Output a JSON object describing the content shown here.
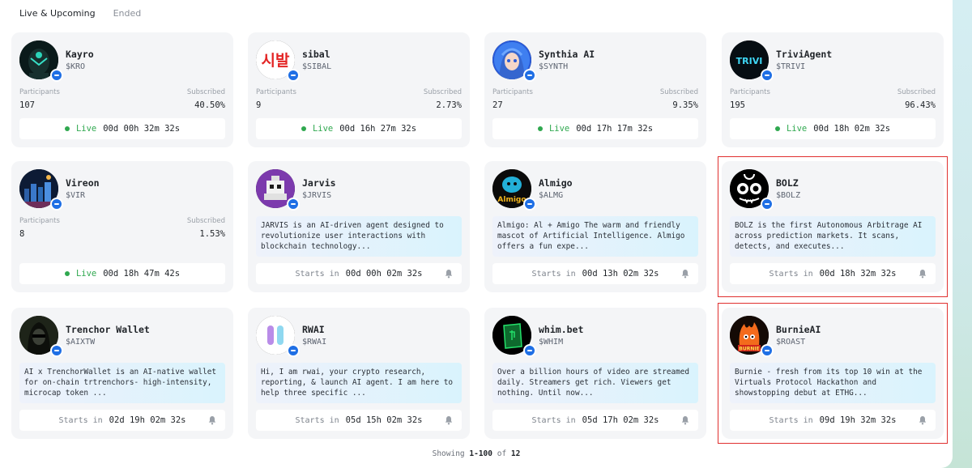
{
  "tabs": [
    {
      "label": "Live & Upcoming",
      "active": true
    },
    {
      "label": "Ended",
      "active": false
    }
  ],
  "labels": {
    "participants": "Participants",
    "subscribed": "Subscribed",
    "live": "Live",
    "starts_in": "Starts in"
  },
  "cards": [
    {
      "name": "Kayro",
      "ticker": "$KRO",
      "status": "live",
      "participants": "107",
      "subscribed": "40.50%",
      "timer": "00d 00h 32m 32s",
      "avatar_icon": "robot-avatar-icon"
    },
    {
      "name": "sibal",
      "ticker": "$SIBAL",
      "status": "live",
      "participants": "9",
      "subscribed": "2.73%",
      "timer": "00d 16h 27m 32s",
      "avatar_icon": "sibal-logo-icon",
      "avatar_text": "시발"
    },
    {
      "name": "Synthia AI",
      "ticker": "$SYNTH",
      "status": "live",
      "participants": "27",
      "subscribed": "9.35%",
      "timer": "00d 17h 17m 32s",
      "avatar_icon": "anime-girl-avatar-icon"
    },
    {
      "name": "TriviAgent",
      "ticker": "$TRIVI",
      "status": "live",
      "participants": "195",
      "subscribed": "96.43%",
      "timer": "00d 18h 02m 32s",
      "avatar_icon": "trivi-logo-icon",
      "avatar_text": "TRIVI"
    },
    {
      "name": "Vireon",
      "ticker": "$VIR",
      "status": "live",
      "participants": "8",
      "subscribed": "1.53%",
      "timer": "00d 18h 47m 42s",
      "avatar_icon": "city-avatar-icon"
    },
    {
      "name": "Jarvis",
      "ticker": "$JRVIS",
      "status": "upcoming",
      "description": "JARVIS is an AI-driven agent designed to revolutionize user interactions with blockchain technology...",
      "timer": "00d 00h 02m 32s",
      "avatar_icon": "pixel-robot-avatar-icon"
    },
    {
      "name": "Almigo",
      "ticker": "$ALMG",
      "status": "upcoming",
      "description": "Almigo: Al + Amigo The warm and friendly mascot of Artificial Intelligence. Almigo offers a fun expe...",
      "timer": "00d 13h 02m 32s",
      "avatar_icon": "almigo-mascot-icon",
      "avatar_text": "Almigo"
    },
    {
      "name": "BOLZ",
      "ticker": "$BOLZ",
      "status": "upcoming",
      "description": "BOLZ is the first Autonomous Arbitrage AI across prediction markets. It scans, detects, and executes...",
      "timer": "00d 18h 32m 32s",
      "avatar_icon": "bolz-face-icon",
      "highlight": true
    },
    {
      "name": "Trenchor Wallet",
      "ticker": "$AIXTW",
      "status": "upcoming",
      "description": "AI x TrenchorWallet is an AI-native wallet for on-chain trtrenchors- high-intensity, microcap token ...",
      "timer": "02d 19h 02m 32s",
      "avatar_icon": "hooded-figure-avatar-icon"
    },
    {
      "name": "RWAI",
      "ticker": "$RWAI",
      "status": "upcoming",
      "description": "Hi, I am rwai, your crypto research, reporting, & launch AI agent. I am here to help three specific ...",
      "timer": "05d 15h 02m 32s",
      "avatar_icon": "rwai-logo-icon"
    },
    {
      "name": "whim.bet",
      "ticker": "$WHIM",
      "status": "upcoming",
      "description": "Over a billion hours of video are streamed daily. Streamers get rich. Viewers get nothing. Until now...",
      "timer": "05d 17h 02m 32s",
      "avatar_icon": "whim-logo-icon"
    },
    {
      "name": "BurnieAI",
      "ticker": "$ROAST",
      "status": "upcoming",
      "description": "Burnie - fresh from its top 10 win at the Virtuals Protocol Hackathon and showstopping debut at ETHG...",
      "timer": "09d 19h 32m 32s",
      "avatar_icon": "burnie-flame-avatar-icon",
      "avatar_text": "BURNIE",
      "highlight": true
    }
  ],
  "footer": {
    "prefix": "Showing",
    "range": "1-100",
    "of": "of",
    "total": "12"
  },
  "colors": {
    "live": "#2fa84f",
    "badge": "#1f6fe5",
    "highlight": "#e0302f",
    "card_bg": "#f4f5f7"
  }
}
